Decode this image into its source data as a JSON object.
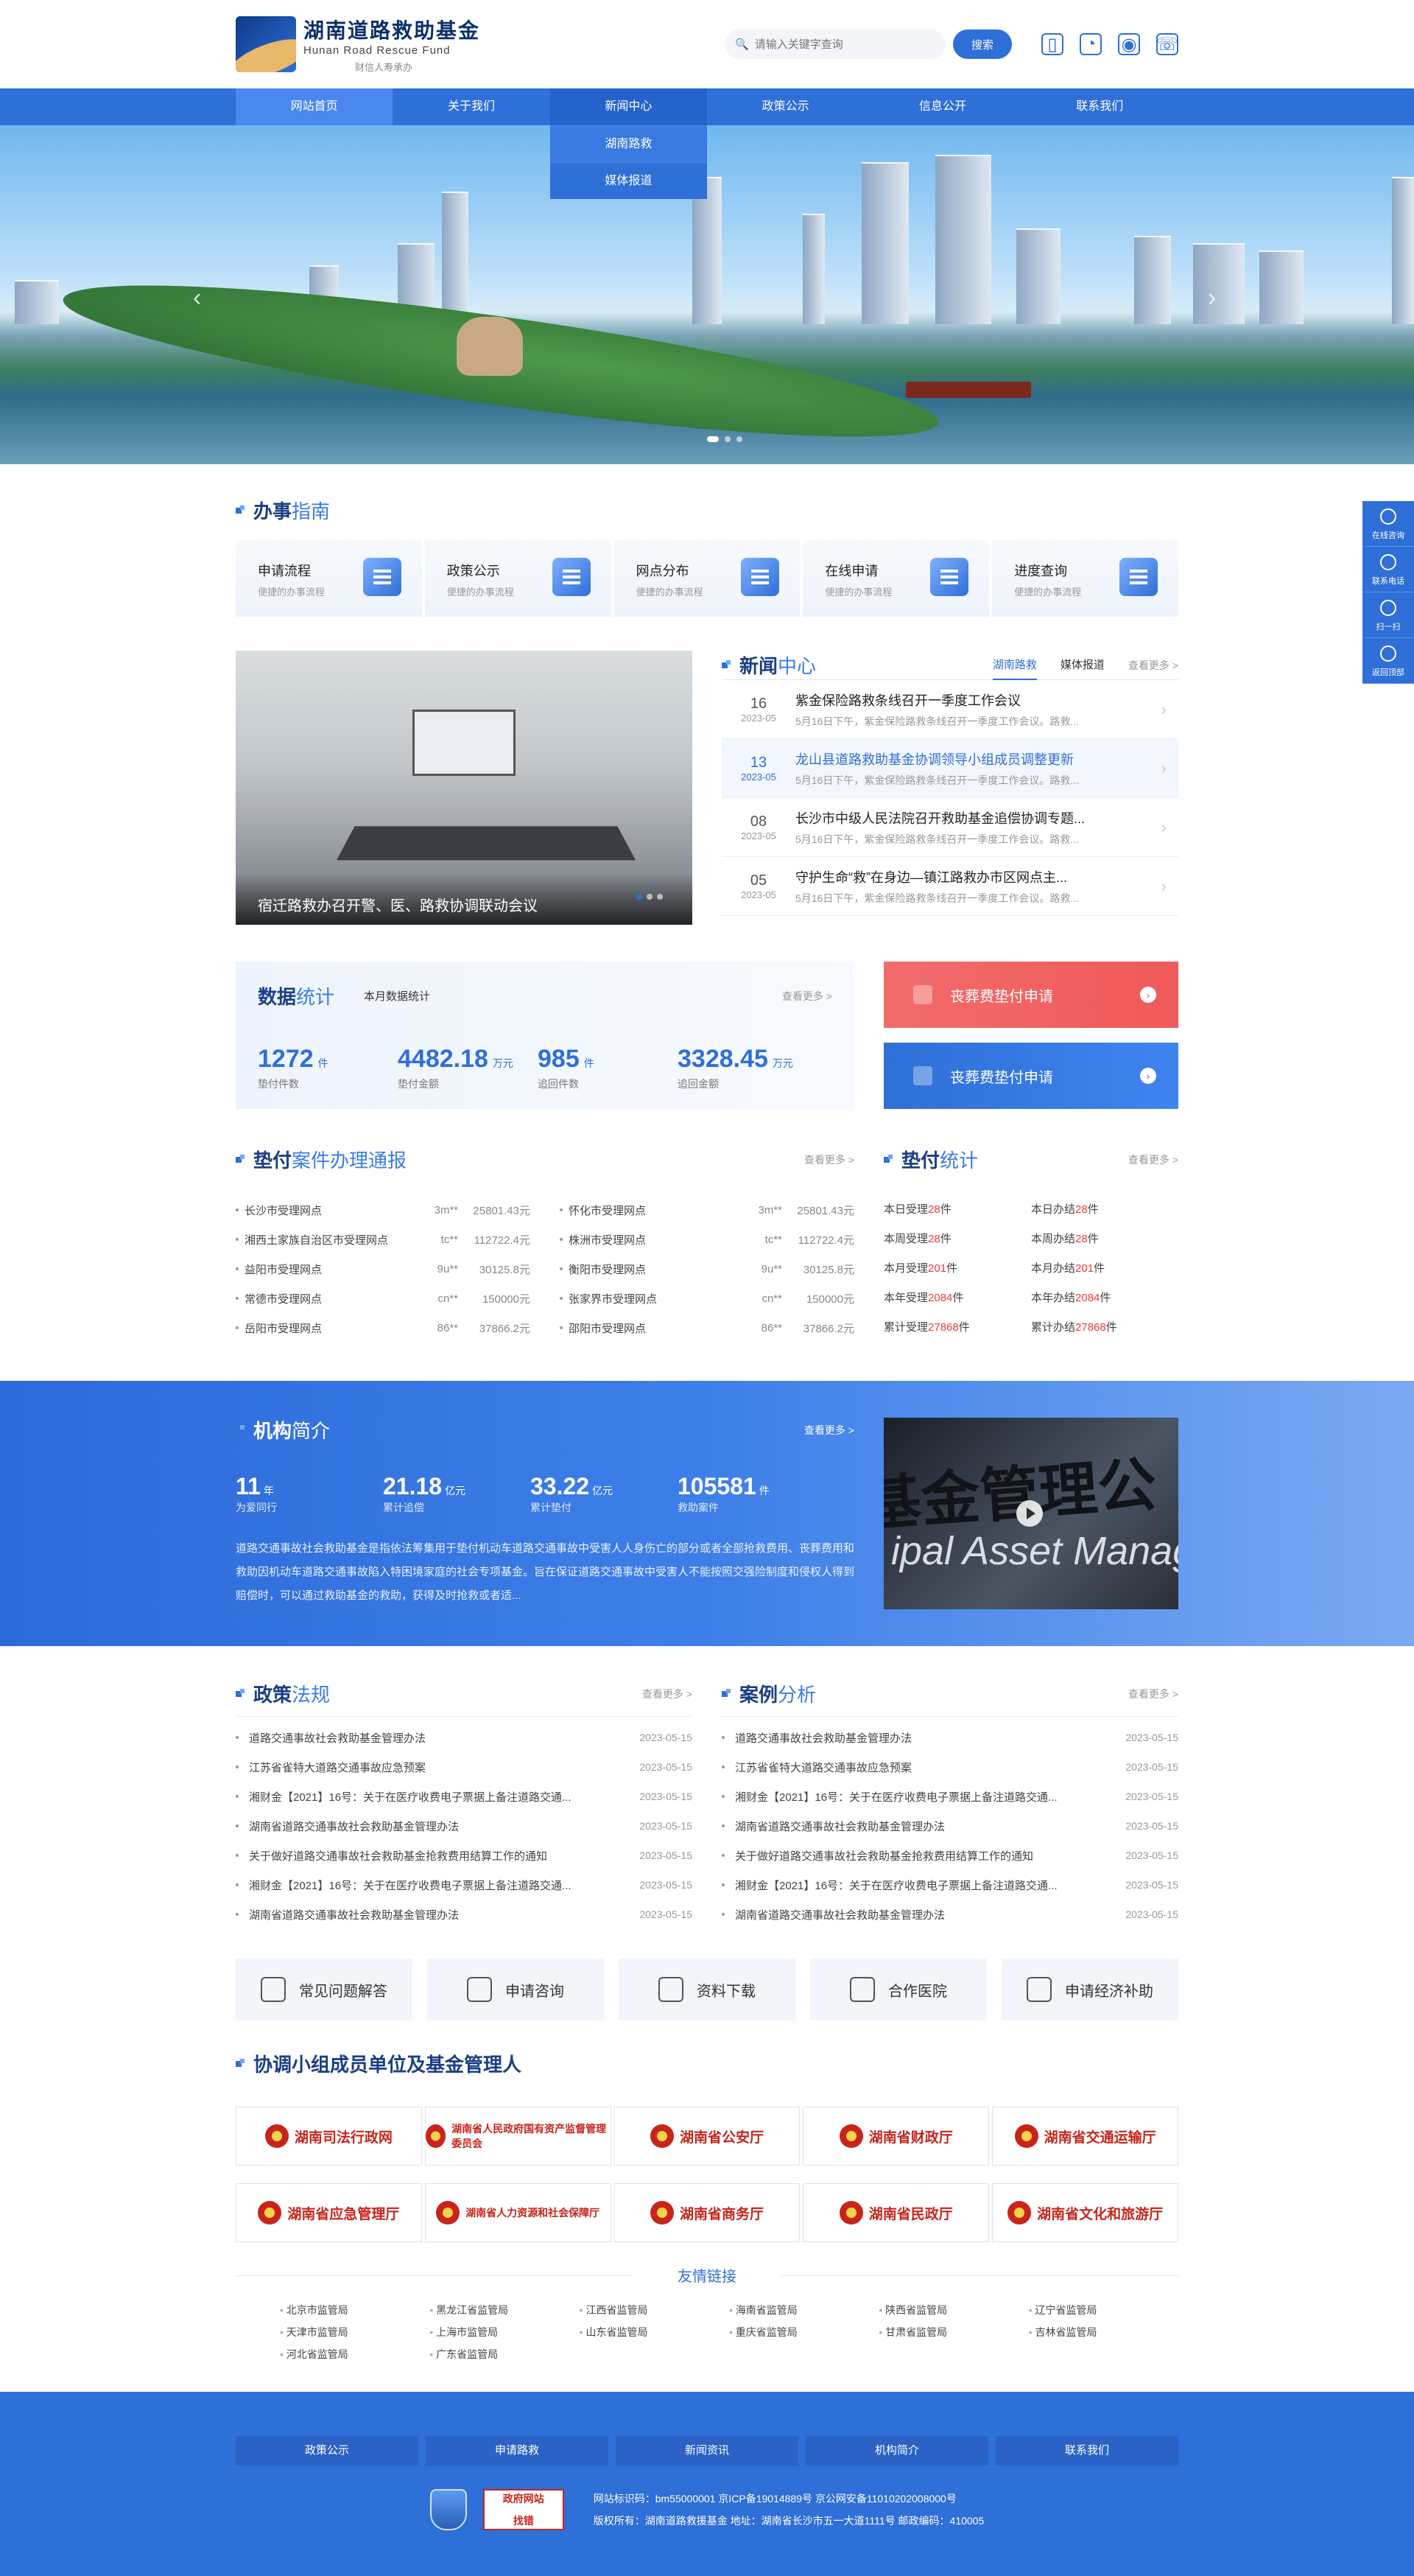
{
  "header": {
    "logo_cn": "湖南道路救助基金",
    "logo_en": "Hunan Road Rescue Fund",
    "slogan": "财信人寿承办",
    "search_placeholder": "请输入关键字查询",
    "search_button": "搜索",
    "icons": [
      "mobile-icon",
      "wechat-icon",
      "weibo-icon",
      "phone-icon"
    ]
  },
  "nav": {
    "items": [
      "网站首页",
      "关于我们",
      "新闻中心",
      "政策公示",
      "信息公开",
      "联系我们"
    ],
    "dropdown": [
      "湖南路救",
      "媒体报道"
    ]
  },
  "services": {
    "title_bold": "办事",
    "title_light": "指南",
    "items": [
      {
        "name": "申请流程",
        "sub": "便捷的办事流程"
      },
      {
        "name": "政策公示",
        "sub": "便捷的办事流程"
      },
      {
        "name": "网点分布",
        "sub": "便捷的办事流程"
      },
      {
        "name": "在线申请",
        "sub": "便捷的办事流程"
      },
      {
        "name": "进度查询",
        "sub": "便捷的办事流程"
      }
    ]
  },
  "news": {
    "photo_caption": "宿迁路救办召开警、医、路救协调联动会议",
    "title_bold": "新闻",
    "title_light": "中心",
    "tabs": [
      "湖南路救",
      "媒体报道"
    ],
    "more": "查看更多 >",
    "items": [
      {
        "day": "16",
        "ym": "2023-05",
        "title": "紫金保险路救条线召开一季度工作会议",
        "desc": "5月16日下午，紫金保险路救条线召开一季度工作会议。路救..."
      },
      {
        "day": "13",
        "ym": "2023-05",
        "title": "龙山县道路救助基金协调领导小组成员调整更新",
        "desc": "5月16日下午，紫金保险路救条线召开一季度工作会议。路救..."
      },
      {
        "day": "08",
        "ym": "2023-05",
        "title": "长沙市中级人民法院召开救助基金追偿协调专题...",
        "desc": "5月16日下午，紫金保险路救条线召开一季度工作会议。路救..."
      },
      {
        "day": "05",
        "ym": "2023-05",
        "title": "守护生命“救”在身边—镇江路救办市区网点主...",
        "desc": "5月16日下午，紫金保险路救条线召开一季度工作会议。路救..."
      }
    ]
  },
  "stats": {
    "title_bold": "数据",
    "title_light": "统计",
    "sub": "本月数据统计",
    "more": "查看更多 >",
    "values": [
      {
        "num": "1272",
        "unit": "件",
        "label": "垫付件数"
      },
      {
        "num": "4482.18",
        "unit": "万元",
        "label": "垫付金额"
      },
      {
        "num": "985",
        "unit": "件",
        "label": "追回件数"
      },
      {
        "num": "3328.45",
        "unit": "万元",
        "label": "追回金额"
      }
    ],
    "apply": [
      "丧葬费垫付申请",
      "丧葬费垫付申请"
    ]
  },
  "cases": {
    "title_bold": "垫付",
    "title_light": "案件办理通报",
    "more": "查看更多 >",
    "left": [
      {
        "name": "长沙市受理网点",
        "code": "3m**",
        "amt": "25801.43元"
      },
      {
        "name": "湘西土家族自治区市受理网点",
        "code": "tc**",
        "amt": "112722.4元"
      },
      {
        "name": "益阳市受理网点",
        "code": "9u**",
        "amt": "30125.8元"
      },
      {
        "name": "常德市受理网点",
        "code": "cn**",
        "amt": "150000元"
      },
      {
        "name": "岳阳市受理网点",
        "code": "86**",
        "amt": "37866.2元"
      }
    ],
    "right": [
      {
        "name": "怀化市受理网点",
        "code": "3m**",
        "amt": "25801.43元"
      },
      {
        "name": "株洲市受理网点",
        "code": "tc**",
        "amt": "112722.4元"
      },
      {
        "name": "衡阳市受理网点",
        "code": "9u**",
        "amt": "30125.8元"
      },
      {
        "name": "张家界市受理网点",
        "code": "cn**",
        "amt": "150000元"
      },
      {
        "name": "邵阳市受理网点",
        "code": "86**",
        "amt": "37866.2元"
      }
    ]
  },
  "dstat": {
    "title_bold": "垫付",
    "title_light": "统计",
    "more": "查看更多 >",
    "rows": [
      {
        "a_label": "本日受理",
        "a_num": "28",
        "b_label": "本日办结",
        "b_num": "28"
      },
      {
        "a_label": "本周受理",
        "a_num": "28",
        "b_label": "本周办结",
        "b_num": "28"
      },
      {
        "a_label": "本月受理",
        "a_num": "201",
        "b_label": "本月办结",
        "b_num": "201"
      },
      {
        "a_label": "本年受理",
        "a_num": "2084",
        "b_label": "本年办结",
        "b_num": "2084"
      },
      {
        "a_label": "累计受理",
        "a_num": "27868",
        "b_label": "累计办结",
        "b_num": "27868"
      }
    ],
    "unit": "件"
  },
  "org": {
    "title_bold": "机构",
    "title_light": "简介",
    "more": "查看更多 >",
    "nums": [
      {
        "num": "11",
        "unit": "年",
        "label": "为爱同行"
      },
      {
        "num": "21.18",
        "unit": "亿元",
        "label": "累计追偿"
      },
      {
        "num": "33.22",
        "unit": "亿元",
        "label": "累计垫付"
      },
      {
        "num": "105581",
        "unit": "件",
        "label": "救助案件"
      }
    ],
    "text": "道路交通事故社会救助基金是指依法筹集用于垫付机动车道路交通事故中受害人人身伤亡的部分或者全部抢救费用、丧葬费用和救助因机动车道路交通事故陷入特困境家庭的社会专项基金。旨在保证道路交通事故中受害人不能按照交强险制度和侵权人得到赔偿时，可以通过救助基金的救助，获得及时抢救或者适...",
    "video_text": "基金管理公",
    "video_text2": "ipal Asset Managemen"
  },
  "policy": {
    "title_bold": "政策",
    "title_light": "法规",
    "more": "查看更多 >",
    "items": [
      {
        "t": "道路交通事故社会救助基金管理办法",
        "d": "2023-05-15"
      },
      {
        "t": "江苏省雀特大道路交通事故应急预案",
        "d": "2023-05-15"
      },
      {
        "t": "湘财金【2021】16号：关于在医疗收费电子票据上备注道路交通...",
        "d": "2023-05-15"
      },
      {
        "t": "湖南省道路交通事故社会救助基金管理办法",
        "d": "2023-05-15"
      },
      {
        "t": "关于做好道路交通事故社会救助基金抢救费用结算工作的通知",
        "d": "2023-05-15"
      },
      {
        "t": "湘财金【2021】16号：关于在医疗收费电子票据上备注道路交通...",
        "d": "2023-05-15"
      },
      {
        "t": "湖南省道路交通事故社会救助基金管理办法",
        "d": "2023-05-15"
      }
    ]
  },
  "case_analysis": {
    "title_bold": "案例",
    "title_light": "分析",
    "more": "查看更多 >",
    "items": [
      {
        "t": "道路交通事故社会救助基金管理办法",
        "d": "2023-05-15"
      },
      {
        "t": "江苏省雀特大道路交通事故应急预案",
        "d": "2023-05-15"
      },
      {
        "t": "湘财金【2021】16号：关于在医疗收费电子票据上备注道路交通...",
        "d": "2023-05-15"
      },
      {
        "t": "湖南省道路交通事故社会救助基金管理办法",
        "d": "2023-05-15"
      },
      {
        "t": "关于做好道路交通事故社会救助基金抢救费用结算工作的通知",
        "d": "2023-05-15"
      },
      {
        "t": "湘财金【2021】16号：关于在医疗收费电子票据上备注道路交通...",
        "d": "2023-05-15"
      },
      {
        "t": "湖南省道路交通事故社会救助基金管理办法",
        "d": "2023-05-15"
      }
    ]
  },
  "quick": [
    "常见问题解答",
    "申请咨询",
    "资料下载",
    "合作医院",
    "申请经济补助"
  ],
  "members": {
    "title_bold": "协调小组成员单位及基金管理人",
    "items": [
      "湖南司法行政网",
      "湖南省人民政府国有资产监督管理委员会",
      "湖南省公安厅",
      "湖南省财政厅",
      "湖南省交通运输厅",
      "湖南省应急管理厅",
      "湖南省人力资源和社会保障厅",
      "湖南省商务厅",
      "湖南省民政厅",
      "湖南省文化和旅游厅"
    ]
  },
  "links": {
    "title": "友情链接",
    "items": [
      "北京市监管局",
      "黑龙江省监管局",
      "江西省监管局",
      "海南省监管局",
      "陕西省监管局",
      "辽宁省监管局",
      "天津市监管局",
      "上海市监管局",
      "山东省监管局",
      "重庆省监管局",
      "甘肃省监管局",
      "吉林省监管局",
      "河北省监管局",
      "广东省监管局"
    ]
  },
  "footer": {
    "nav": [
      "政策公示",
      "申请路救",
      "新闻资讯",
      "机构简介",
      "联系我们"
    ],
    "gov_badge": "政府网站\n找错",
    "line1": "网站标识码：bm55000001   京ICP备19014889号   京公网安备11010202008000号",
    "line2": "版权所有：湖南道路救援基金   地址：湖南省长沙市五一大道1111号   邮政编码：410005"
  },
  "side": [
    "在线咨询",
    "联系电话",
    "扫一扫",
    "返回顶部"
  ],
  "colors": {
    "primary": "#2f6fd8",
    "red": "#f05a5a",
    "footer": "#2f6fd8"
  }
}
